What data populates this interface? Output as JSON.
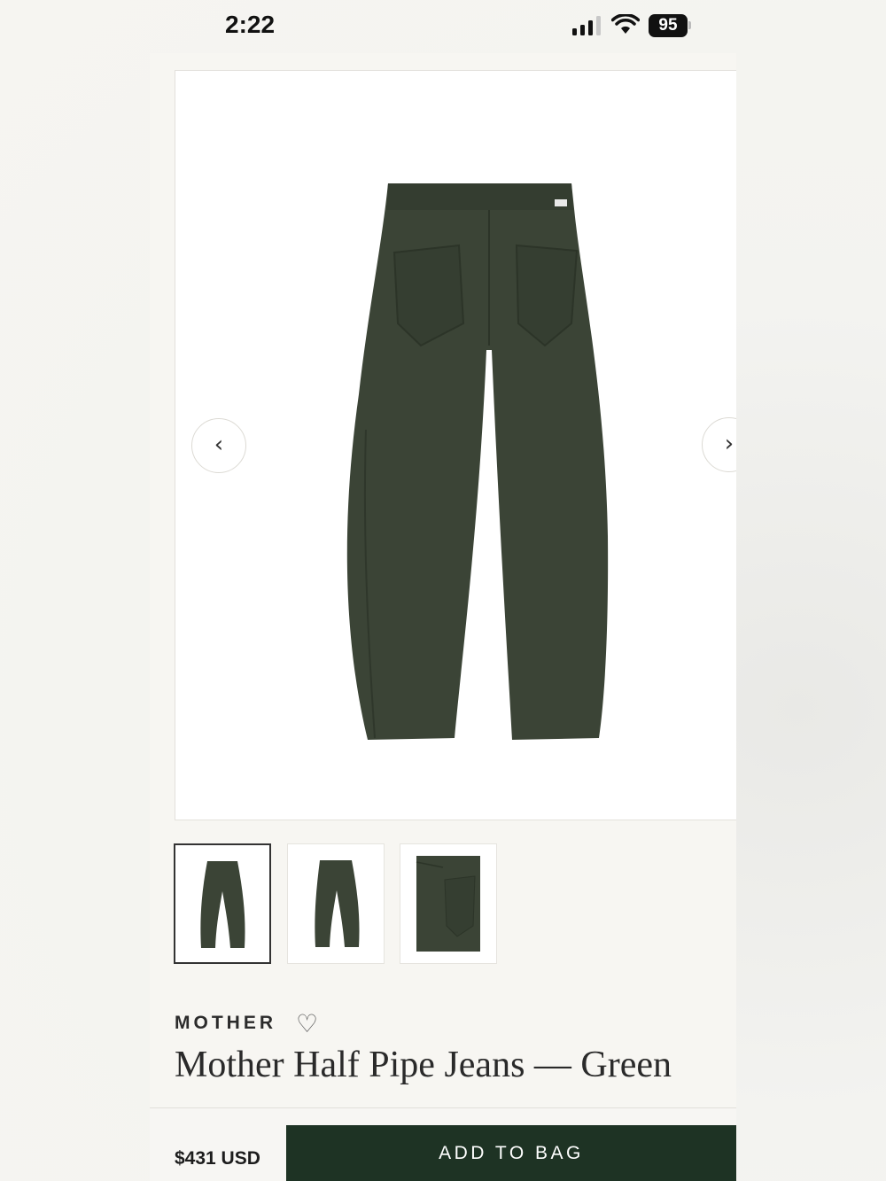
{
  "status_bar": {
    "time": "2:22",
    "battery": "95"
  },
  "product": {
    "brand": "MOTHER",
    "title": "Mother Half Pipe Jeans — Green",
    "price": "$431 USD",
    "color_swatch": "#3b4436"
  },
  "gallery": {
    "prev_label": "‹",
    "next_label": "›",
    "thumbnails": [
      "front-view",
      "back-view",
      "pocket-detail"
    ],
    "active_index": 0
  },
  "icons": {
    "favorite": "heart-outline-icon"
  },
  "actions": {
    "add_to_bag": "ADD TO BAG"
  },
  "colors": {
    "button_bg": "#1e3324",
    "panel_bg": "#f7f6f2"
  }
}
